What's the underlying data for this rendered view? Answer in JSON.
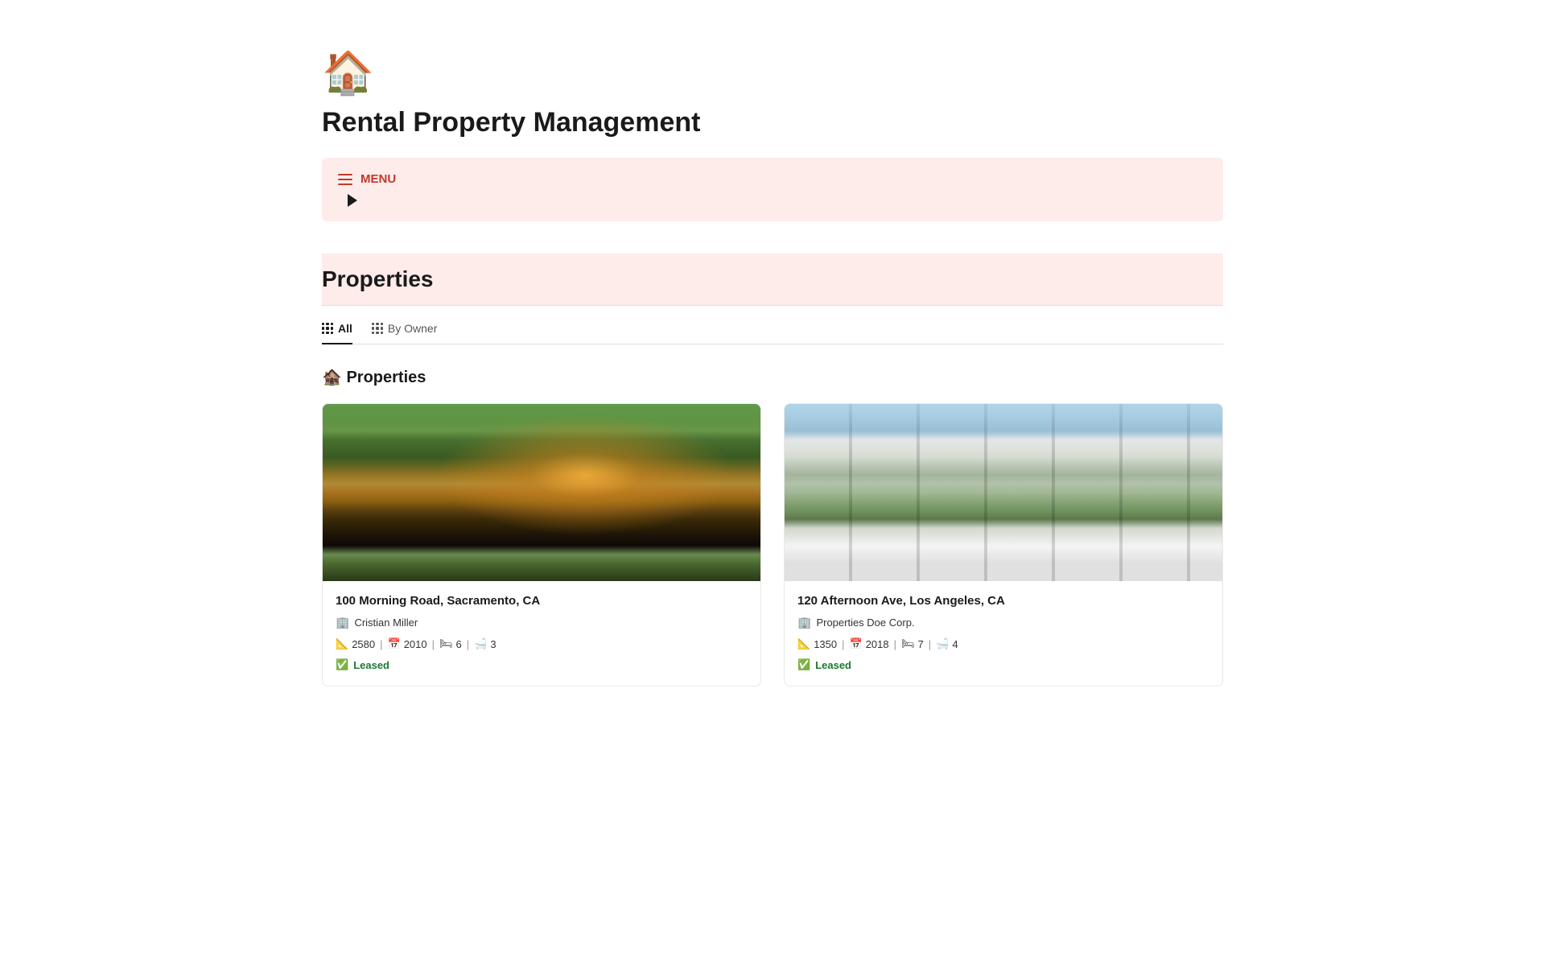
{
  "app": {
    "logo": "🏠",
    "title": "Rental Property Management"
  },
  "menu": {
    "label": "MENU",
    "toggle_visible": true
  },
  "sections": {
    "properties": {
      "title": "Properties",
      "subsection_title": "🏚️ Properties",
      "tabs": [
        {
          "label": "All",
          "active": true
        },
        {
          "label": "By Owner",
          "active": false
        }
      ]
    }
  },
  "cards": [
    {
      "address": "100 Morning Road, Sacramento, CA",
      "owner": "Cristian Miller",
      "owner_icon": "🏢",
      "sqft": "2580",
      "year": "2010",
      "beds": "6",
      "baths": "3",
      "status": "Leased",
      "status_icon": "✅",
      "image_type": "morning-road"
    },
    {
      "address": "120 Afternoon Ave, Los Angeles, CA",
      "owner": "Properties Doe Corp.",
      "owner_icon": "🏢",
      "sqft": "1350",
      "year": "2018",
      "beds": "7",
      "baths": "4",
      "status": "Leased",
      "status_icon": "✅",
      "image_type": "afternoon-ave"
    }
  ],
  "icons": {
    "sqft": "📐",
    "year": "📅",
    "beds": "🛏",
    "baths": "🛁"
  }
}
